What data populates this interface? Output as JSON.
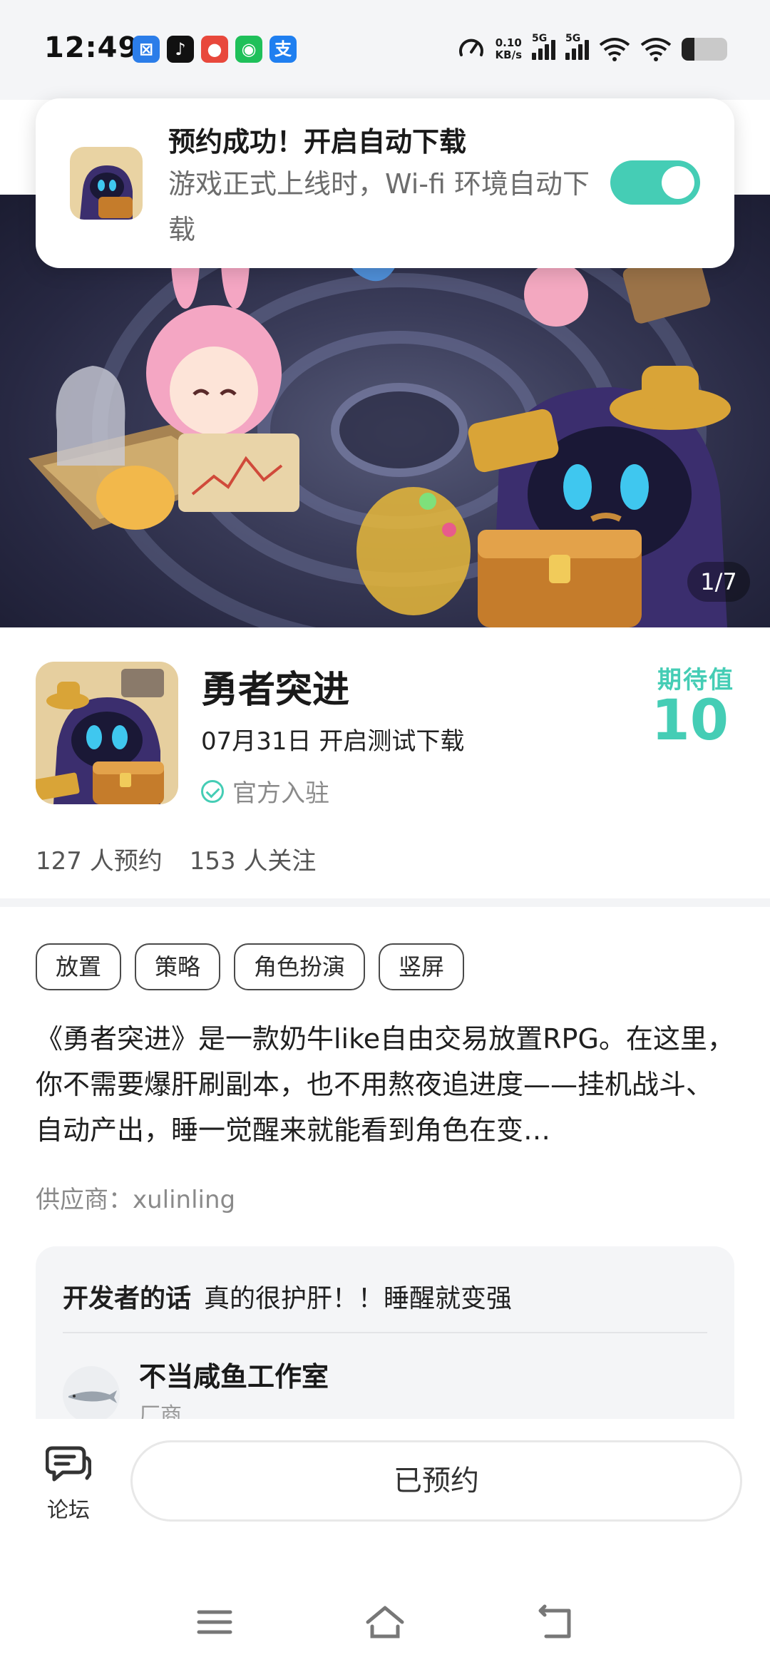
{
  "status_bar": {
    "time": "12:49",
    "apps": [
      {
        "name": "mail-app-icon",
        "glyph": "⊠",
        "color": "#2b7de9"
      },
      {
        "name": "tiktok-icon",
        "glyph": "♪",
        "color": "#111111"
      },
      {
        "name": "reddit-app-icon",
        "glyph": "●",
        "color": "#e8483c"
      },
      {
        "name": "wechat-icon",
        "glyph": "◉",
        "color": "#1fc05a"
      },
      {
        "name": "alipay-icon",
        "glyph": "支",
        "color": "#1f7ff0"
      }
    ],
    "net_speed_value": "0.10",
    "net_speed_unit": "KB/s",
    "signal1_label": "5G",
    "signal2_label": "5G",
    "battery_level": 0.28
  },
  "toast": {
    "title": "预约成功！开启自动下载",
    "description": "游戏正式上线时，Wi-fi 环境自动下载",
    "auto_download_enabled": true
  },
  "banner": {
    "counter": "1/7"
  },
  "game": {
    "title": "勇者突进",
    "date_text": "07月31日 开启测试下载",
    "official_text": "官方入驻",
    "expect_label": "期待值",
    "expect_value": "10",
    "reservations": "127 人预约",
    "followers": "153 人关注"
  },
  "tags": [
    "放置",
    "策略",
    "角色扮演",
    "竖屏"
  ],
  "description": "《勇者突进》是一款奶牛like自由交易放置RPG。在这里，你不需要爆肝刷副本，也不用熬夜追进度——挂机战斗、自动产出，睡一觉醒来就能看到角色在变…",
  "supplier": "供应商：xulinling",
  "developer": {
    "header_label": "开发者的话",
    "header_text": "真的很护肝！！睡醒就变强",
    "studio_name": "不当咸鱼工作室",
    "role": "厂商"
  },
  "action_bar": {
    "forum_label": "论坛",
    "reserve_label": "已预约"
  },
  "colors": {
    "accent": "#45cdb5",
    "text_secondary": "#8a8a8a"
  }
}
